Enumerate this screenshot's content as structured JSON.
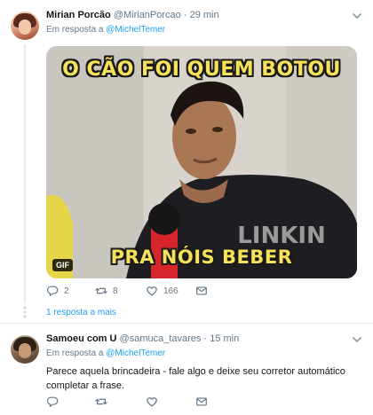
{
  "tweets": [
    {
      "name": "Mirian Porcão",
      "handle": "@MirianPorcao",
      "separator": "·",
      "time": "29 min",
      "reply_prefix": "Em resposta a",
      "reply_mention": "@MichelTemer",
      "media": {
        "badge": "GIF",
        "caption_top": "O CÃO FOI QUEM BOTOU",
        "caption_bottom": "PRA NÓIS BEBER",
        "shirt_text": "LINKIN"
      },
      "actions": {
        "reply_count": "2",
        "retweet_count": "8",
        "like_count": "166",
        "reply_icon": "reply-icon",
        "retweet_icon": "retweet-icon",
        "like_icon": "heart-icon",
        "dm_icon": "envelope-icon"
      },
      "more_replies": "1 resposta a mais"
    },
    {
      "name": "Samoeu com U",
      "handle": "@samuca_tavares",
      "separator": "·",
      "time": "15 min",
      "reply_prefix": "Em resposta a",
      "reply_mention": "@MichelTemer",
      "text": "Parece aquela brincadeira - fale algo e deixe seu corretor automático completar a frase.",
      "actions": {
        "reply_icon": "reply-icon",
        "retweet_icon": "retweet-icon",
        "like_icon": "heart-icon",
        "dm_icon": "envelope-icon"
      }
    }
  ],
  "colors": {
    "link": "#1da1f2",
    "secondary_text": "#657786",
    "primary_text": "#14171a",
    "caption": "#f5e15a"
  }
}
